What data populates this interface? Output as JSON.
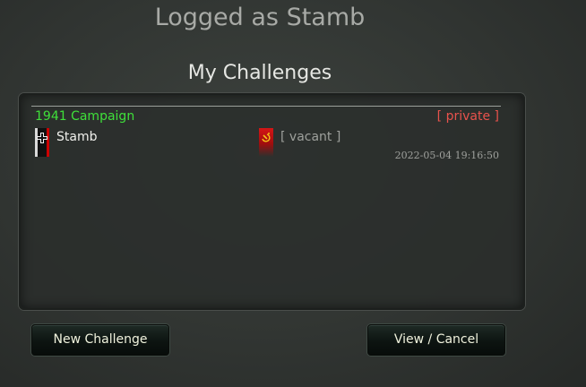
{
  "header": {
    "login_status": "Logged as Stamb",
    "section_title": "My Challenges"
  },
  "challenges": [
    {
      "campaign": "1941 Campaign",
      "privacy": "[ private ]",
      "player1": {
        "name": "Stamb",
        "flag_icon": "german-iron-cross-flag-icon"
      },
      "player2": {
        "name": "[ vacant ]",
        "flag_icon": "soviet-hammer-sickle-flag-icon"
      },
      "date": "2022-05-04 19:16:50"
    }
  ],
  "buttons": {
    "new_challenge": "New Challenge",
    "view_cancel": "View / Cancel"
  },
  "colors": {
    "campaign": "#3fe03a",
    "private": "#e8524c",
    "button_text": "#f0f2dd"
  }
}
